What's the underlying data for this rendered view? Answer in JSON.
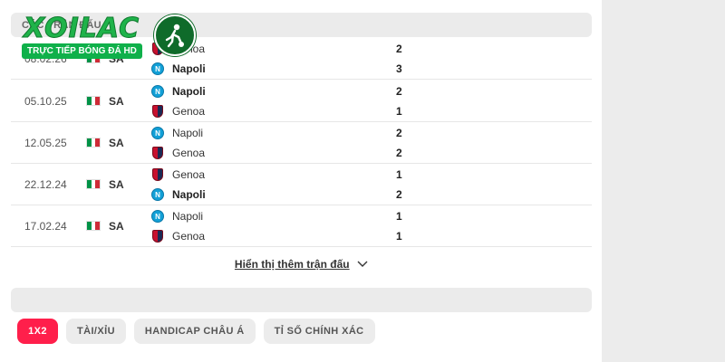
{
  "logo": {
    "brand": "XOILAC",
    "tagline": "TRỰC TIẾP BÓNG ĐÁ HD"
  },
  "section": {
    "title": "CÁC TRẬN ĐẤU"
  },
  "matches": [
    {
      "date": "08.02.26",
      "competition": "SA",
      "home": "Genoa",
      "away": "Napoli",
      "home_score": "2",
      "away_score": "3",
      "winner": "away"
    },
    {
      "date": "05.10.25",
      "competition": "SA",
      "home": "Napoli",
      "away": "Genoa",
      "home_score": "2",
      "away_score": "1",
      "winner": "home"
    },
    {
      "date": "12.05.25",
      "competition": "SA",
      "home": "Napoli",
      "away": "Genoa",
      "home_score": "2",
      "away_score": "2",
      "winner": "none"
    },
    {
      "date": "22.12.24",
      "competition": "SA",
      "home": "Genoa",
      "away": "Napoli",
      "home_score": "1",
      "away_score": "2",
      "winner": "away"
    },
    {
      "date": "17.02.24",
      "competition": "SA",
      "home": "Napoli",
      "away": "Genoa",
      "home_score": "1",
      "away_score": "1",
      "winner": "none"
    }
  ],
  "show_more": "Hiển thị thêm trận đấu",
  "odds_tabs": [
    "1X2",
    "TÀI/XỈU",
    "HANDICAP CHÂU Á",
    "TỈ SỐ CHÍNH XÁC"
  ],
  "colors": {
    "accent": "#ff1f4b",
    "brand_green": "#1fb34a",
    "napoli_blue": "#12a0d7",
    "genoa_red": "#c8102e"
  }
}
